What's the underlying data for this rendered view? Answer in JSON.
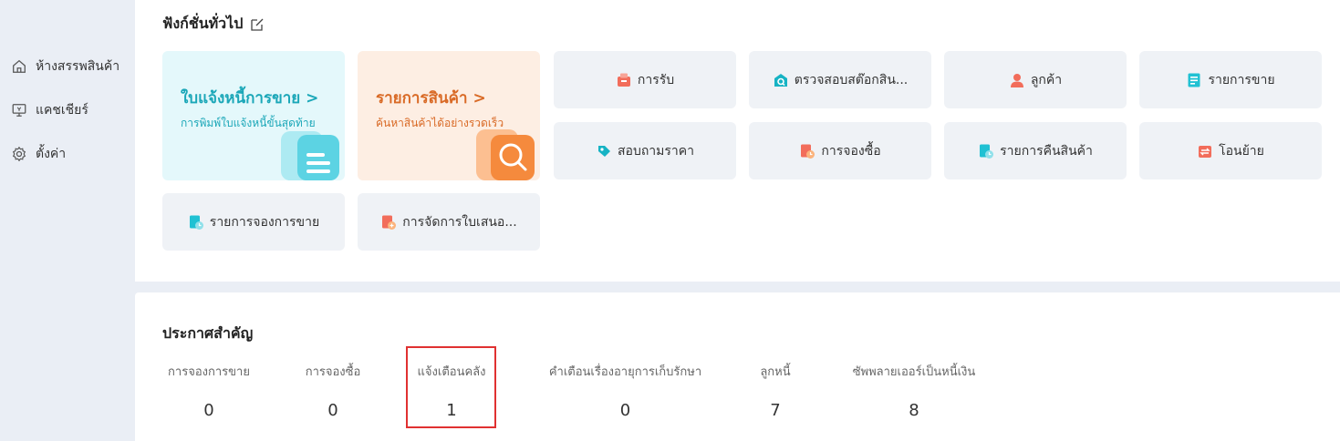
{
  "sidebar": {
    "items": [
      {
        "label": "ห้างสรรพสินค้า",
        "icon": "home-icon"
      },
      {
        "label": "แคชเชียร์",
        "icon": "monitor-icon"
      },
      {
        "label": "ตั้งค่า",
        "icon": "gear-icon"
      }
    ]
  },
  "functions": {
    "title": "ฟังก์ชั่นทั่วไป",
    "edit_icon": "edit-icon",
    "big_cards": [
      {
        "title": "ใบแจ้งหนี้การขาย >",
        "subtitle": "การพิมพ์ใบแจ้งหนี้ขั้นสุดท้าย",
        "color": "#1ba7b8"
      },
      {
        "title": "รายการสินค้า >",
        "subtitle": "ค้นหาสินค้าได้อย่างรวดเร็ว",
        "color": "#d96a26"
      }
    ],
    "small_cards": [
      {
        "label": "การรับ",
        "icon": "receive-icon"
      },
      {
        "label": "ตรวจสอบสต๊อกสิน...",
        "icon": "stock-check-icon"
      },
      {
        "label": "ลูกค้า",
        "icon": "customer-icon"
      },
      {
        "label": "รายการขาย",
        "icon": "sales-list-icon"
      },
      {
        "label": "สอบถามราคา",
        "icon": "price-inquiry-icon"
      },
      {
        "label": "การจองซื้อ",
        "icon": "purchase-order-icon"
      },
      {
        "label": "รายการคืนสินค้า",
        "icon": "return-list-icon"
      },
      {
        "label": "โอนย้าย",
        "icon": "transfer-icon"
      },
      {
        "label": "รายการจองการขาย",
        "icon": "sales-reservation-icon"
      },
      {
        "label": "การจัดการใบเสนอ...",
        "icon": "quotation-icon"
      }
    ]
  },
  "announcements": {
    "title": "ประกาศสำคัญ",
    "stats": [
      {
        "label": "การจองการขาย",
        "value": "0"
      },
      {
        "label": "การจองซื้อ",
        "value": "0"
      },
      {
        "label": "แจ้งเตือนคลัง",
        "value": "1"
      },
      {
        "label": "คำเตือนเรื่องอายุการเก็บรักษา",
        "value": "0"
      },
      {
        "label": "ลูกหนี้",
        "value": "7"
      },
      {
        "label": "ซัพพลายเออร์เป็นหนี้เงิน",
        "value": "8"
      }
    ],
    "highlight_color": "#e03131"
  }
}
